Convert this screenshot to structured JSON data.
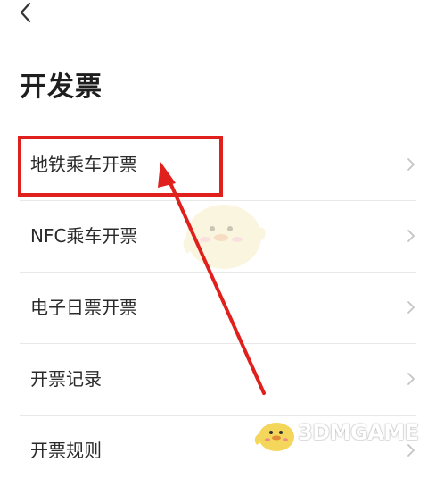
{
  "header": {
    "back_icon": "chevron-left-icon",
    "title": "开发票"
  },
  "menu": {
    "items": [
      {
        "label": "地铁乘车开票",
        "icon": "chevron-right-icon",
        "highlighted": true
      },
      {
        "label": "NFC乘车开票",
        "icon": "chevron-right-icon"
      },
      {
        "label": "电子日票开票",
        "icon": "chevron-right-icon"
      },
      {
        "label": "开票记录",
        "icon": "chevron-right-icon"
      },
      {
        "label": "开票规则",
        "icon": "chevron-right-icon"
      }
    ]
  },
  "annotation": {
    "highlight_color": "#e0201c",
    "arrow_color": "#e0201c"
  },
  "watermark": {
    "text": "3DMGAME",
    "icon": "chick-mascot-icon"
  },
  "colors": {
    "background": "#ffffff",
    "text": "#2b2b2b",
    "chevron": "#c4c4c4",
    "divider": "#e8e8e8"
  }
}
